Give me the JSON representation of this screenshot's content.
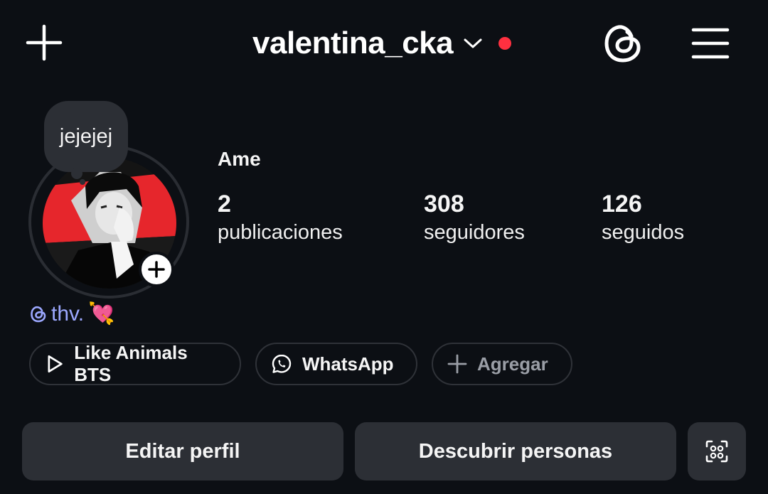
{
  "header": {
    "username": "valentina_cka",
    "icons": {
      "add": "plus-icon",
      "dropdown": "chevron-down-icon",
      "notification_dot": "red-dot",
      "threads": "threads-icon",
      "menu": "hamburger-menu-icon"
    },
    "accent_color": "#ff3040"
  },
  "profile": {
    "note": "jejejej",
    "display_name": "Ame",
    "stats": [
      {
        "value": "2",
        "label": "publicaciones"
      },
      {
        "value": "308",
        "label": "seguidores"
      },
      {
        "value": "126",
        "label": "seguidos"
      }
    ],
    "threads_handle": "thv.",
    "threads_emoji": "💘"
  },
  "links": [
    {
      "label": "Like Animals BTS",
      "icon": "play-icon"
    },
    {
      "label": "WhatsApp",
      "icon": "whatsapp-icon"
    },
    {
      "label": "Agregar",
      "icon": "plus-icon"
    }
  ],
  "actions": {
    "edit": "Editar perfil",
    "discover": "Descubrir personas",
    "extra_icon": "people-scan-icon"
  }
}
